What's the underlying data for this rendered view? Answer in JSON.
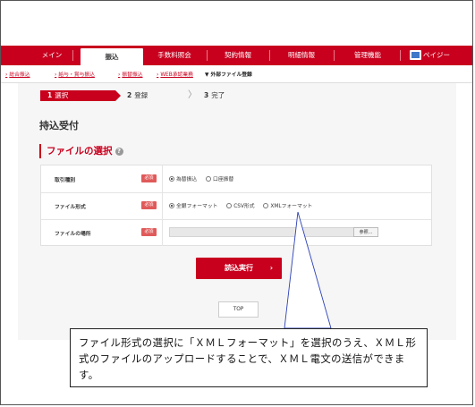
{
  "nav": {
    "items": [
      "メイン",
      "振込",
      "手数料照会",
      "契約情報",
      "明細情報",
      "管理機能",
      "ペイジー"
    ],
    "active": "振込"
  },
  "breadcrumb": {
    "items": [
      "総合振込",
      "給与・賞与振込",
      "振替振込",
      "WEB承認業務"
    ],
    "current": "外部ファイル登録"
  },
  "steps": [
    {
      "num": "1",
      "label": "選択"
    },
    {
      "num": "2",
      "label": "登録"
    },
    {
      "num": "3",
      "label": "完了"
    }
  ],
  "page_title": "持込受付",
  "section_title": "ファイルの選択",
  "help_icon": "?",
  "form": {
    "required_badge": "必須",
    "rows": [
      {
        "label": "取引種別",
        "options": [
          "為替振込",
          "口座振替"
        ],
        "selected": 0
      },
      {
        "label": "ファイル形式",
        "options": [
          "全銀フォーマット",
          "CSV形式",
          "XMLフォーマット"
        ],
        "selected": 0
      },
      {
        "label": "ファイルの場所",
        "browse_label": "参照..."
      }
    ]
  },
  "submit_label": "読込実行",
  "top_label": "TOP",
  "callout": {
    "text": "ファイル形式の選択に「ＸＭＬフォーマット」を選択のうえ、ＸＭＬ形式のファイルのアップロードすることで、ＸＭＬ電文の送信ができます。"
  },
  "colors": {
    "brand": "#c8001e",
    "required": "#e05a5a"
  }
}
